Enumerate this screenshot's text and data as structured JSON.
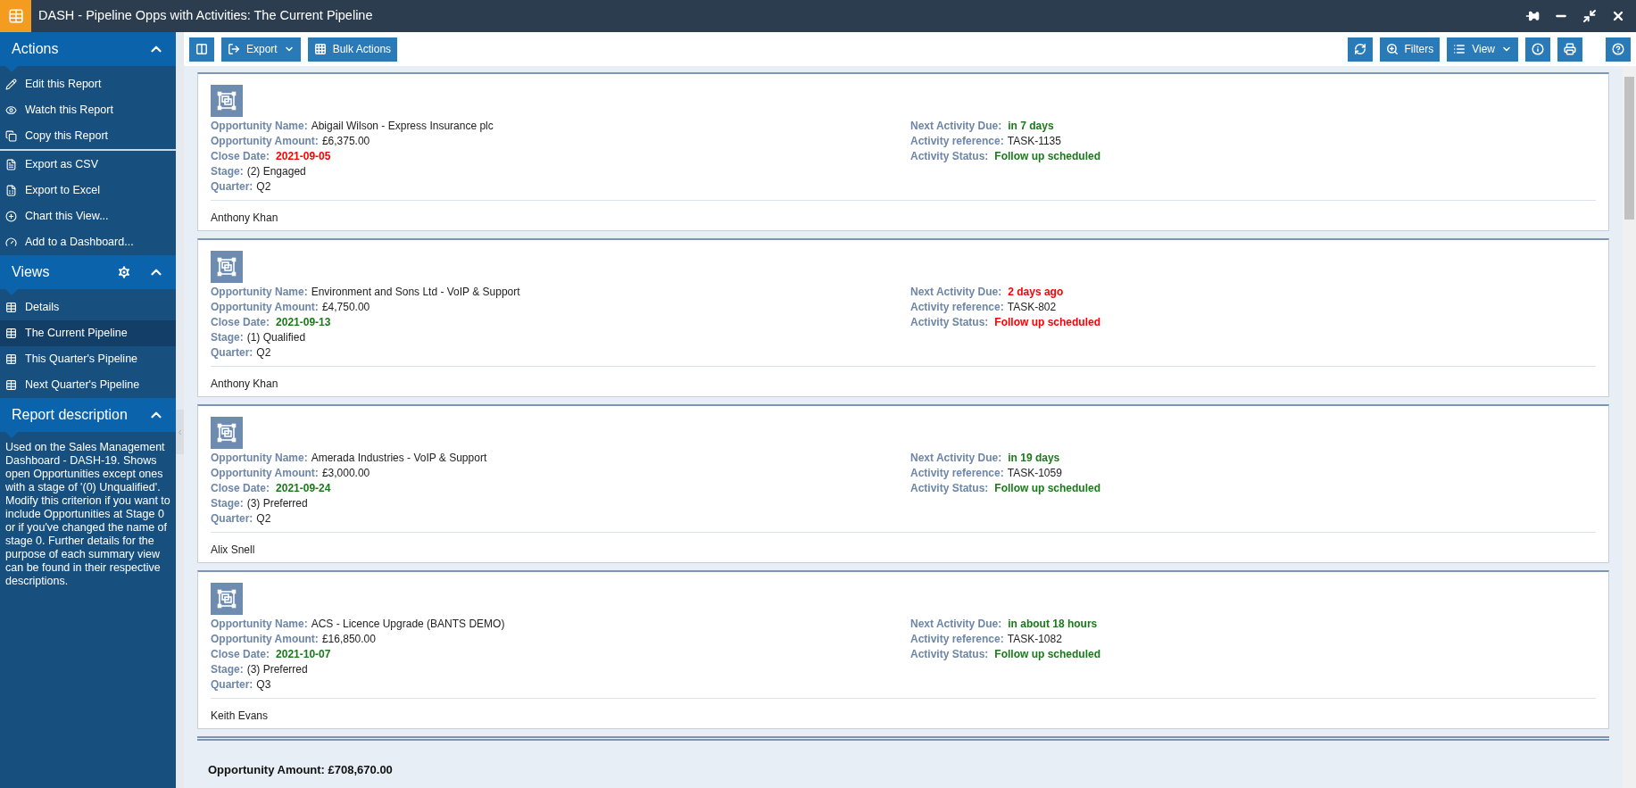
{
  "window": {
    "title": "DASH - Pipeline Opps with Activities: The Current Pipeline"
  },
  "sidebar": {
    "sections": [
      {
        "title": "Actions",
        "expanded": true,
        "has_settings": false,
        "groups": [
          [
            {
              "label": "Edit this Report",
              "selected": false
            },
            {
              "label": "Watch this Report",
              "selected": false
            },
            {
              "label": "Copy this Report",
              "selected": false
            }
          ],
          [
            {
              "label": "Export as CSV",
              "selected": false
            },
            {
              "label": "Export to Excel",
              "selected": false
            },
            {
              "label": "Chart this View...",
              "selected": false
            },
            {
              "label": "Add to a Dashboard...",
              "selected": false
            }
          ]
        ]
      },
      {
        "title": "Views",
        "expanded": true,
        "has_settings": true,
        "groups": [
          [
            {
              "label": "Details",
              "selected": false
            },
            {
              "label": "The Current Pipeline",
              "selected": true
            },
            {
              "label": "This Quarter's Pipeline",
              "selected": false
            },
            {
              "label": "Next Quarter's Pipeline",
              "selected": false
            }
          ]
        ]
      },
      {
        "title": "Report description",
        "expanded": true,
        "has_settings": false,
        "text": "Used on the Sales Management Dashboard - DASH-19. Shows open Opportunities except ones with a stage of '(0) Unqualified'. Modify this criterion if you want to include Opportunities at Stage 0 or if you've changed the name of stage 0. Further details for the purpose of each summary view can be found in their respective descriptions."
      }
    ]
  },
  "toolbar": {
    "left": [
      {
        "dropdown": false
      },
      {
        "label": "Export",
        "dropdown": true
      },
      {
        "label": "Bulk Actions",
        "dropdown": false
      }
    ],
    "right": [
      {
        "dropdown": false
      },
      {
        "label": "Filters",
        "dropdown": false
      },
      {
        "label": "View",
        "dropdown": true
      },
      {
        "dropdown": false
      },
      {
        "dropdown": false
      },
      {
        "dropdown": false
      }
    ]
  },
  "cards": [
    {
      "left": [
        {
          "label": "Opportunity Name:",
          "value": "Abigail Wilson - Express Insurance plc"
        },
        {
          "label": "Opportunity Amount:",
          "value": "£6,375.00"
        },
        {
          "label": "Close Date:",
          "value": "2021-09-05",
          "color": "#ff0000"
        },
        {
          "label": "Stage:",
          "value": "(2) Engaged"
        },
        {
          "label": "Quarter:",
          "value": "Q2"
        }
      ],
      "right": [
        {
          "label": "Next Activity Due:",
          "value": "in 7 days",
          "color": "#1a7a1a"
        },
        {
          "label": "Activity reference:",
          "value": "TASK-1135"
        },
        {
          "label": "Activity Status:",
          "value": "Follow up scheduled",
          "color": "#1a7a1a"
        }
      ],
      "owner": "Anthony Khan"
    },
    {
      "left": [
        {
          "label": "Opportunity Name:",
          "value": "Environment and Sons Ltd - VoIP & Support"
        },
        {
          "label": "Opportunity Amount:",
          "value": "£4,750.00"
        },
        {
          "label": "Close Date:",
          "value": "2021-09-13",
          "color": "#1a7a1a"
        },
        {
          "label": "Stage:",
          "value": "(1) Qualified"
        },
        {
          "label": "Quarter:",
          "value": "Q2"
        }
      ],
      "right": [
        {
          "label": "Next Activity Due:",
          "value": "2 days ago",
          "color": "#ff0000"
        },
        {
          "label": "Activity reference:",
          "value": "TASK-802"
        },
        {
          "label": "Activity Status:",
          "value": "Follow up scheduled",
          "color": "#ff0000"
        }
      ],
      "owner": "Anthony Khan"
    },
    {
      "left": [
        {
          "label": "Opportunity Name:",
          "value": "Amerada Industries - VoIP & Support"
        },
        {
          "label": "Opportunity Amount:",
          "value": "£3,000.00"
        },
        {
          "label": "Close Date:",
          "value": "2021-09-24",
          "color": "#1a7a1a"
        },
        {
          "label": "Stage:",
          "value": "(3) Preferred"
        },
        {
          "label": "Quarter:",
          "value": "Q2"
        }
      ],
      "right": [
        {
          "label": "Next Activity Due:",
          "value": "in 19 days",
          "color": "#1a7a1a"
        },
        {
          "label": "Activity reference:",
          "value": "TASK-1059"
        },
        {
          "label": "Activity Status:",
          "value": "Follow up scheduled",
          "color": "#1a7a1a"
        }
      ],
      "owner": "Alix Snell"
    },
    {
      "left": [
        {
          "label": "Opportunity Name:",
          "value": "ACS - Licence Upgrade (BANTS DEMO)"
        },
        {
          "label": "Opportunity Amount:",
          "value": "£16,850.00"
        },
        {
          "label": "Close Date:",
          "value": "2021-10-07",
          "color": "#1a7a1a"
        },
        {
          "label": "Stage:",
          "value": "(3) Preferred"
        },
        {
          "label": "Quarter:",
          "value": "Q3"
        }
      ],
      "right": [
        {
          "label": "Next Activity Due:",
          "value": "in about 18 hours",
          "color": "#1a7a1a"
        },
        {
          "label": "Activity reference:",
          "value": "TASK-1082"
        },
        {
          "label": "Activity Status:",
          "value": "Follow up scheduled",
          "color": "#1a7a1a"
        }
      ],
      "owner": "Keith Evans"
    }
  ],
  "total": {
    "text": "Opportunity Amount: £708,670.00"
  }
}
